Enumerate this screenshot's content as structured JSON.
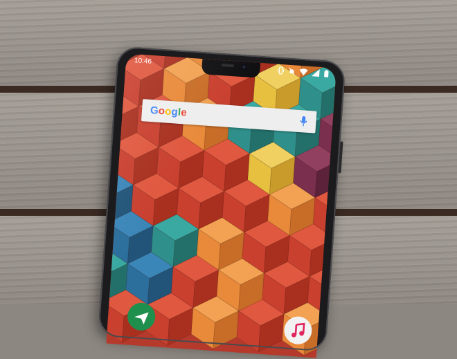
{
  "scene": "phone-on-wooden-table",
  "colors": {
    "wood_plank": "#9b958f",
    "wood_gap": "#3a2a22",
    "phone_frame": "#1b1b1d",
    "cube_red": "#c9402f",
    "cube_orange": "#e98a3a",
    "cube_yellow": "#e8c040",
    "cube_teal": "#2f8f8a",
    "cube_blue": "#2c6f9c",
    "cube_purple": "#7a2f4e"
  },
  "status_bar": {
    "time": "10:46",
    "icons": [
      "vibrate-icon",
      "mute-icon",
      "wifi-icon",
      "signal-icon",
      "battery-icon"
    ]
  },
  "search_widget": {
    "logo": [
      "G",
      "o",
      "o",
      "g",
      "l",
      "e"
    ],
    "mic_icon": "microphone-icon"
  },
  "dock": {
    "icons": [
      "navigation-app-icon",
      "music-app-icon"
    ]
  }
}
